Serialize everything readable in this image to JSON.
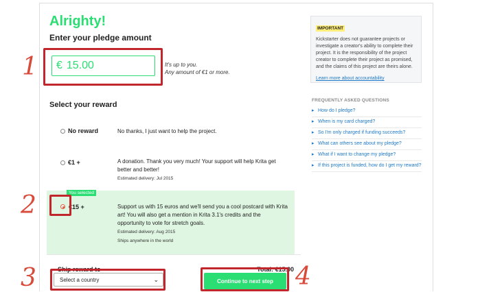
{
  "heading": "Alrighty!",
  "pledge": {
    "label": "Enter your pledge amount",
    "currency": "€",
    "value": "15.00",
    "hint_line1": "It's up to you.",
    "hint_line2": "Any amount of €1 or more."
  },
  "rewards": {
    "label": "Select your reward",
    "items": [
      {
        "amount": "No reward",
        "description": "No thanks, I just want to help the project."
      },
      {
        "amount": "€1 +",
        "description": "A donation. Thank you very much! Your support will help Krita get better and better!",
        "delivery": "Estimated delivery: Jul 2015"
      },
      {
        "amount": "€15 +",
        "badge": "You selected",
        "description": "Support us with 15 euros and we'll send you a cool postcard with Krita art! You will also get a mention in Krita 3.1's credits and the opportunity to vote for stretch goals.",
        "delivery": "Estimated delivery: Aug 2015",
        "shipping": "Ships anywhere in the world"
      }
    ]
  },
  "footer": {
    "ship_label": "Ship reward to",
    "total": "Total: €15.00",
    "country_select": "Select a country",
    "continue_button": "Continue to next step"
  },
  "sidebar": {
    "important_title": "IMPORTANT",
    "important_text": "Kickstarter does not guarantee projects or investigate a creator's ability to complete their project. It is the responsibility of the project creator to complete their project as promised, and the claims of this project are theirs alone.",
    "important_link": "Learn more about accountability",
    "faq_title": "FREQUENTLY ASKED QUESTIONS",
    "faq": [
      "How do I pledge?",
      "When is my card charged?",
      "So I'm only charged if funding succeeds?",
      "What can others see about my pledge?",
      "What if I want to change my pledge?",
      "If this project is funded, how do I get my reward?"
    ]
  },
  "annotations": [
    "1",
    "2",
    "3",
    "4"
  ],
  "colors": {
    "accent": "#2bde73",
    "annotation": "#c0262c",
    "link": "#1d78c8",
    "selected_bg": "#dff6e2"
  }
}
